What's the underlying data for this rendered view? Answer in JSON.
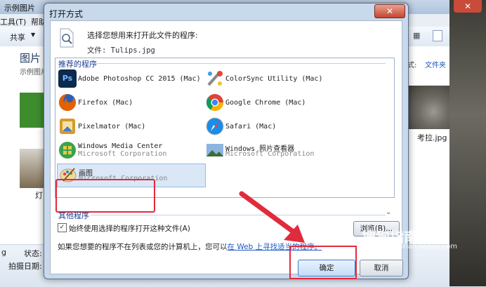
{
  "background_window": {
    "title": "示例图片",
    "menu": [
      "工具(T)",
      "帮助"
    ],
    "toolbar_share": "共享",
    "folder_label": "图片",
    "library_label": "示例图片",
    "arrange_by_label": "文件夹",
    "partial_label": "灯",
    "koala_caption": "考拉.jpg",
    "status_state": "状态:",
    "status_date": "拍摄日期:"
  },
  "dialog": {
    "title": "打开方式",
    "close_glyph": "✕",
    "prompt": "选择您想用来打开此文件的程序:",
    "file_label": "文件: Tulips.jpg",
    "recommended_header": "推荐的程序",
    "other_header": "其他程序",
    "programs": [
      {
        "name": "Adobe Photoshop CC 2015 (Mac)",
        "icon": "photoshop-icon",
        "color": "#0c2a4e"
      },
      {
        "name": "ColorSync Utility (Mac)",
        "icon": "colorsync-icon",
        "color": "#c0c0c0"
      },
      {
        "name": "Firefox (Mac)",
        "icon": "firefox-icon",
        "color": "#e66000"
      },
      {
        "name": "Google Chrome (Mac)",
        "icon": "chrome-icon",
        "color": "#4285f4"
      },
      {
        "name": "Pixelmator (Mac)",
        "icon": "pixelmator-icon",
        "color": "#d79a2b"
      },
      {
        "name": "Safari (Mac)",
        "icon": "safari-icon",
        "color": "#1b8ce8"
      },
      {
        "name": "Windows Media Center",
        "sub": "Microsoft Corporation",
        "icon": "media-center-icon",
        "color": "#3ba24a"
      },
      {
        "name": "Windows 照片查看器",
        "sub": "Microsoft Corporation",
        "icon": "photo-viewer-icon",
        "color": "#4a7fb6"
      },
      {
        "name": "画图",
        "sub": "Microsoft Corporation",
        "icon": "paint-icon",
        "color": "#e7b24d"
      }
    ],
    "always_use_label": "始终使用选择的程序打开这种文件(A)",
    "browse_label": "浏览(B)...",
    "hint_text": "如果您想要的程序不在列表或您的计算机上，您可以",
    "hint_link": "在 Web 上寻找适当的程序。",
    "ok_label": "确定",
    "cancel_label": "取消"
  },
  "watermark": {
    "text": "搜狗指南",
    "sub": "zhinan.sogou.com"
  },
  "colors": {
    "highlight": "#e02b3c",
    "link": "#1c58c4"
  }
}
